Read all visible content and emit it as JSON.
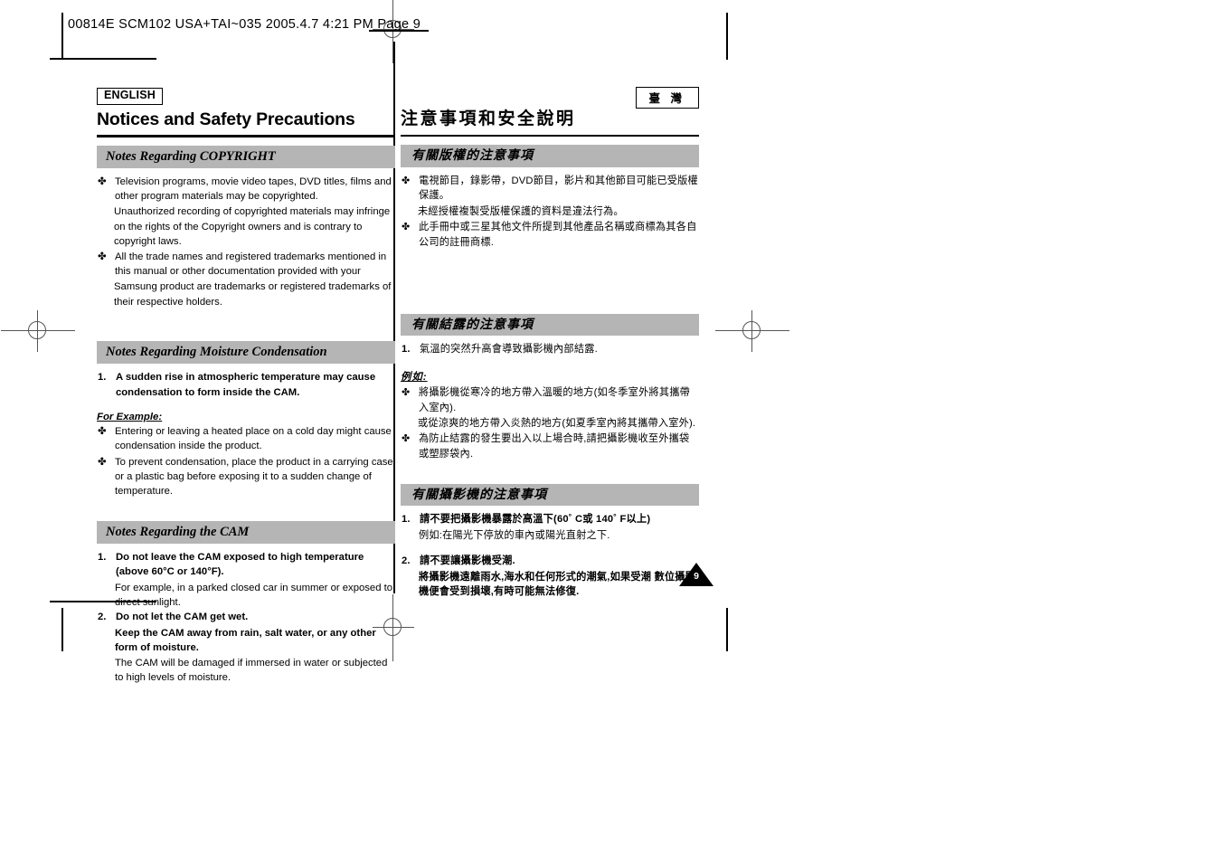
{
  "slug": {
    "text": "00814E SCM102 USA+TAI~035  2005.4.7 4:21 PM  Page 9"
  },
  "page_number_badge": "9",
  "columns": {
    "english": {
      "lang_badge": "ENGLISH",
      "title": "Notices and Safety Precautions",
      "sections": [
        {
          "heading": "Notes Regarding COPYRIGHT",
          "blocks": [
            {
              "type": "bullet",
              "mark": "✤",
              "text": "Television programs, movie video tapes, DVD titles, films and other program materials may be copyrighted."
            },
            {
              "type": "plain",
              "text": "Unauthorized recording of copyrighted materials may infringe on the rights of the Copyright owners and is contrary to copyright laws."
            },
            {
              "type": "bullet",
              "mark": "✤",
              "text": "All the trade names and registered trademarks mentioned in this manual or other documentation provided with your"
            },
            {
              "type": "plain",
              "text": "Samsung product are trademarks or registered trademarks of their respective holders."
            }
          ]
        },
        {
          "heading": "Notes Regarding Moisture Condensation",
          "blocks": [
            {
              "type": "number",
              "mark": "1.",
              "text": "A sudden rise in atmospheric temperature may cause condensation to form inside the CAM.",
              "bold": true
            },
            {
              "type": "label",
              "text": "For Example:"
            },
            {
              "type": "bullet",
              "mark": "✤",
              "text": "Entering or leaving a heated place on a cold day might cause condensation inside the product."
            },
            {
              "type": "bullet",
              "mark": "✤",
              "text": "To prevent condensation, place the product in a carrying case or a plastic bag before exposing it to a sudden change of temperature."
            }
          ]
        },
        {
          "heading": "Notes Regarding the CAM",
          "blocks": [
            {
              "type": "number",
              "mark": "1.",
              "text": "Do not leave the CAM exposed to high temperature (above 60°C or 140°F).",
              "bold": true
            },
            {
              "type": "plain-num",
              "text": "For example, in a parked closed car in summer or exposed to direct sunlight."
            },
            {
              "type": "number",
              "mark": "2.",
              "text": "Do not let the CAM get wet.",
              "bold": true
            },
            {
              "type": "plain-num",
              "text": "Keep the CAM away from rain, salt water, or any other form of moisture.",
              "bold": true
            },
            {
              "type": "plain-num",
              "text": "The CAM will be damaged if immersed in water or subjected to high levels of moisture."
            }
          ]
        }
      ]
    },
    "chinese": {
      "lang_badge": "臺 灣",
      "title": "注意事項和安全說明",
      "sections": [
        {
          "heading": "有關版權的注意事項",
          "blocks": [
            {
              "type": "bullet",
              "mark": "✤",
              "text": "電視節目，錄影帶，DVD節目，影片和其他節目可能已受版權保護。"
            },
            {
              "type": "plain",
              "text": "未經授權複製受版權保護的資料是違法行為。"
            },
            {
              "type": "bullet",
              "mark": "✤",
              "text": "此手冊中或三星其他文件所提到其他產品名稱或商標為其各自公司的註冊商標."
            }
          ]
        },
        {
          "heading": "有關結露的注意事項",
          "blocks": [
            {
              "type": "number",
              "mark": "1.",
              "text": "氣溫的突然升高會導致攝影機內部結露."
            },
            {
              "type": "label",
              "text": "例如:"
            },
            {
              "type": "bullet",
              "mark": "✤",
              "text": "將攝影機從寒冷的地方帶入溫暖的地方(如冬季室外將其攜帶入室內)."
            },
            {
              "type": "plain",
              "text": "或從涼爽的地方帶入炎熱的地方(如夏季室內將其攜帶入室外)."
            },
            {
              "type": "bullet",
              "mark": "✤",
              "text": "為防止結露的發生要出入以上場合時,請把攝影機收至外攜袋或塑膠袋內."
            }
          ]
        },
        {
          "heading": "有關攝影機的注意事項",
          "blocks": [
            {
              "type": "number",
              "mark": "1.",
              "text": "請不要把攝影機暴露於高溫下(60˚ C或 140˚ F以上)",
              "bold": true
            },
            {
              "type": "plain-num",
              "text": "例如:在陽光下停放的車內或陽光直射之下."
            },
            {
              "type": "number",
              "mark": "2.",
              "text": "請不要讓攝影機受潮.",
              "bold": true
            },
            {
              "type": "plain-num",
              "text": "將攝影機遠離雨水,海水和任何形式的潮氣,如果受潮 數位攝影機便會受到損壞,有時可能無法修復.",
              "bold": true
            }
          ]
        }
      ]
    }
  }
}
